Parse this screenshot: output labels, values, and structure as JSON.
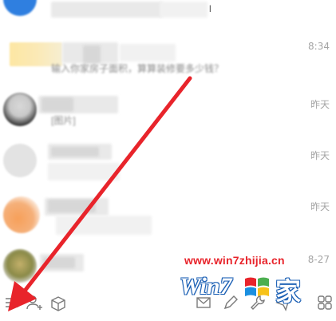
{
  "chat_list": {
    "rows": [
      {
        "time": "",
        "preview": "l"
      },
      {
        "time": "8:34",
        "preview": "输入你家房子面积，算算装修要多少钱？"
      },
      {
        "time": "昨天",
        "preview": "[图片]"
      },
      {
        "time": "昨天",
        "preview": ""
      },
      {
        "time": "昨天",
        "preview": ""
      },
      {
        "time": "8-27",
        "preview": ""
      }
    ]
  },
  "toolbar": {
    "icons": [
      "menu-icon",
      "add-contact-icon",
      "app-box-icon",
      "mail-icon",
      "pen-icon",
      "wrench-icon",
      "send-icon",
      "grid-icon"
    ]
  },
  "watermark": {
    "url": "www.win7zhijia.cn",
    "logo": "Win7",
    "logo_cn": "家"
  },
  "colors": {
    "arrow": "#e8242b",
    "time": "#a5a5a5",
    "icon": "#7a7a7a",
    "watermark_blue": "#1a5fb4"
  }
}
